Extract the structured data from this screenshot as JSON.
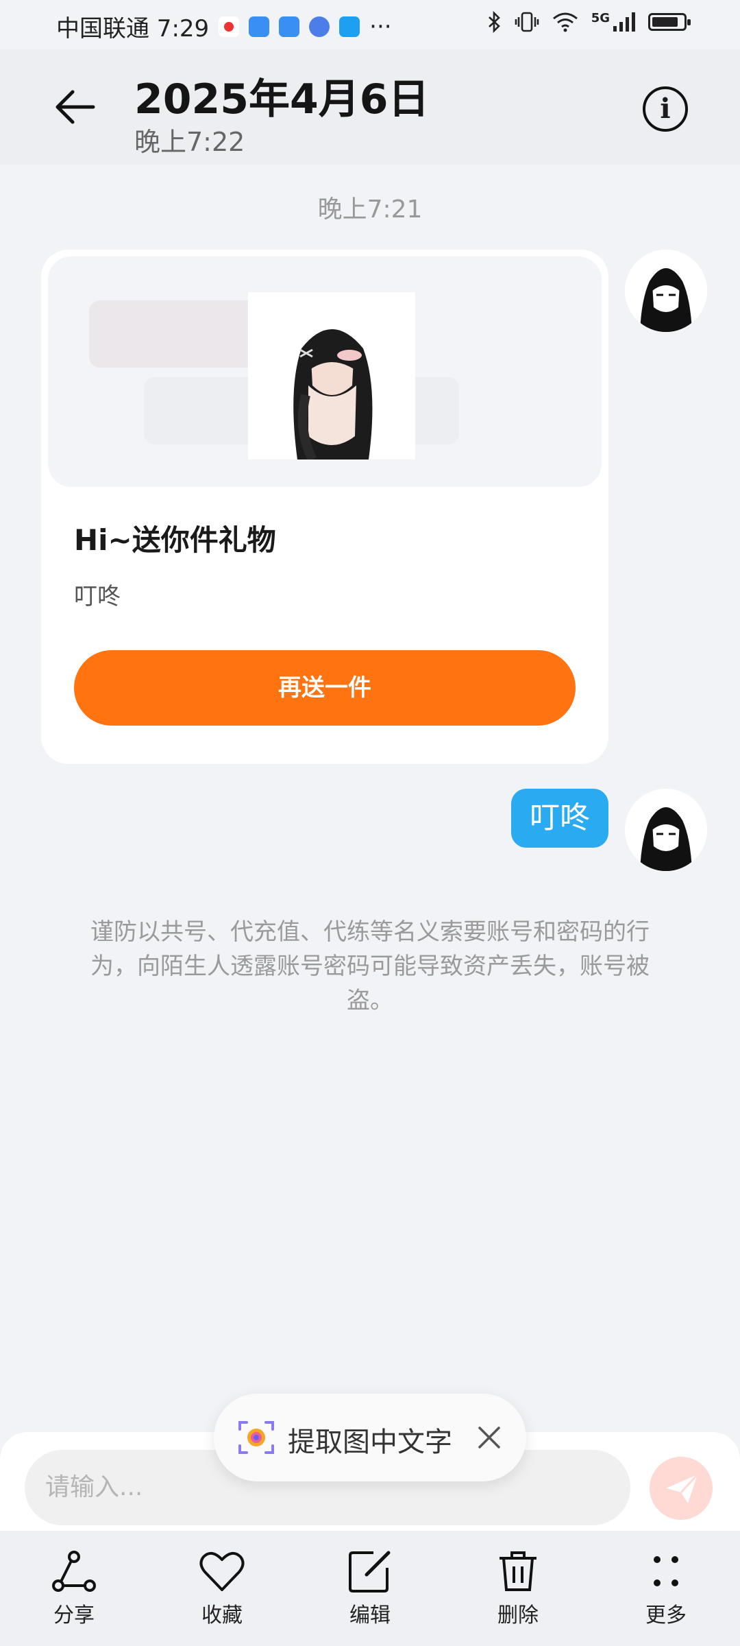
{
  "status_bar": {
    "carrier_time": "中国联通 7:29",
    "notification_icons": [
      "record-icon",
      "cloud-icon",
      "cloud-icon",
      "browser-icon",
      "search-app-icon"
    ],
    "more": "···",
    "network": "5G",
    "battery_level": 0.85
  },
  "header": {
    "title": "2025年4月6日",
    "subtitle": "晚上7:22",
    "back_icon": "back-arrow-icon",
    "info_icon": "info-icon"
  },
  "chat": {
    "timestamp": "晚上7:21",
    "gift_card": {
      "title": "Hi~送你件礼物",
      "subtitle": "叮咚",
      "button": "再送一件"
    },
    "bubble_text": "叮咚",
    "warning": "谨防以共号、代充值、代练等名义索要账号和密码的行为，向陌生人透露账号密码可能导致资产丢失，账号被盗。"
  },
  "input": {
    "placeholder": "请输入..."
  },
  "toast": {
    "label": "提取图中文字"
  },
  "toolbar": {
    "items": [
      {
        "label": "分享",
        "icon": "share-icon"
      },
      {
        "label": "收藏",
        "icon": "heart-icon"
      },
      {
        "label": "编辑",
        "icon": "edit-icon"
      },
      {
        "label": "删除",
        "icon": "trash-icon"
      },
      {
        "label": "更多",
        "icon": "more-icon"
      }
    ]
  },
  "colors": {
    "accent_orange": "#ff7311",
    "bubble_blue": "#2aaaf0",
    "background": "#f1f3f6"
  }
}
